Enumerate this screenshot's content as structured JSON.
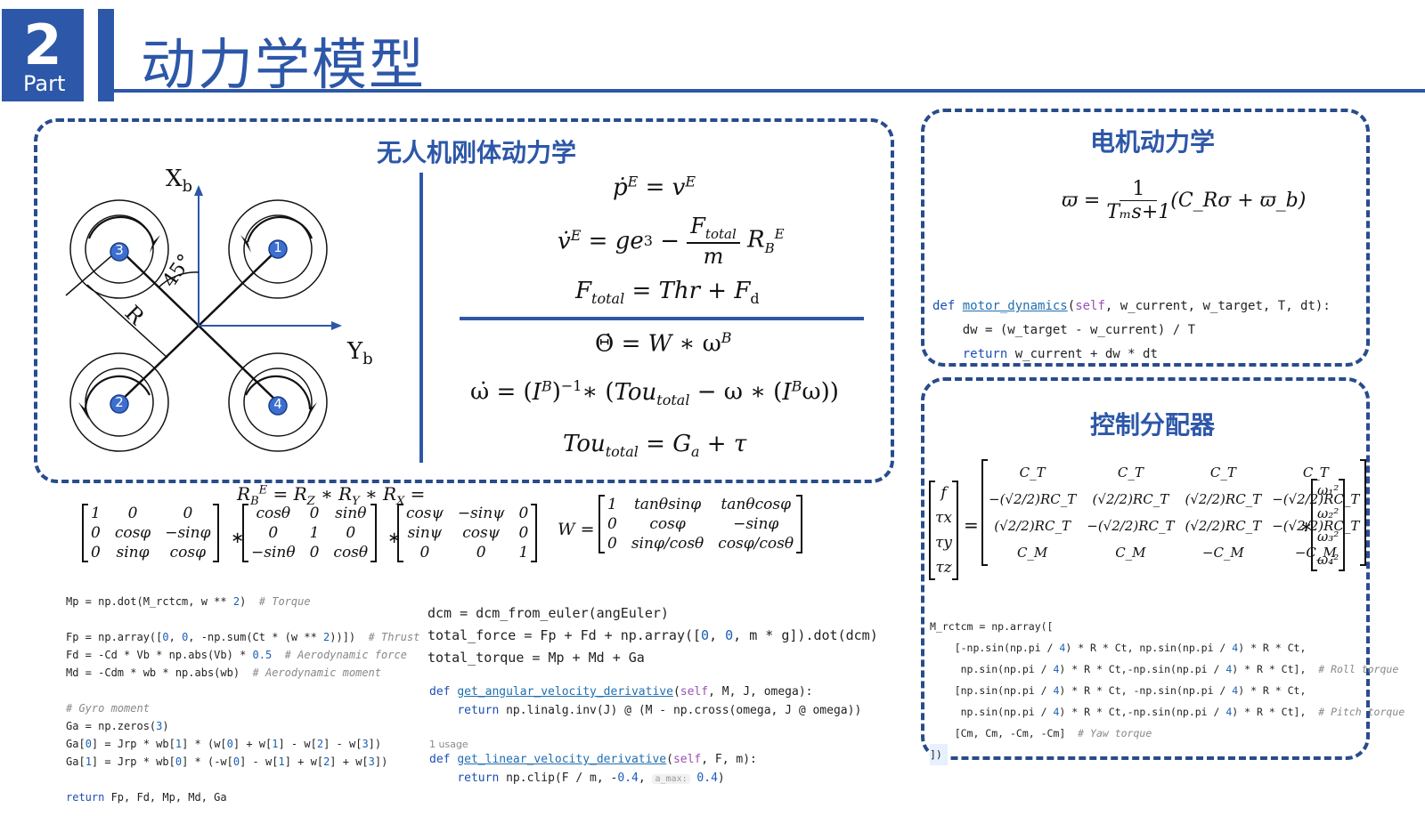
{
  "header": {
    "part_number": "2",
    "part_word": "Part",
    "title": "动力学模型"
  },
  "rigid_body": {
    "title": "无人机刚体动力学",
    "axis_x": "X",
    "axis_x_sub": "b",
    "axis_y": "Y",
    "axis_y_sub": "b",
    "angle": "45°",
    "arm": "R",
    "rotors": [
      "1",
      "2",
      "3",
      "4"
    ],
    "eq_translational": [
      "ṗᴱ = vᴱ",
      "v̇ᴱ = ge₃ − (F_total / m) R_Bᴱ",
      "F_total = Thr + F_d"
    ],
    "eq_rotational": [
      "Θ̇ = W ∗ ωᴮ",
      "ω̇ = (Iᴮ)⁻¹∗ (Tou_total − ω ∗ (Iᴮω))",
      "Tou_total = G_a + τ"
    ]
  },
  "rotation": {
    "rbe_eq": "R_Bᴱ = R_Z ∗ R_Y ∗ R_X =",
    "rx": [
      [
        "1",
        "0",
        "0"
      ],
      [
        "0",
        "cosφ",
        "−sinφ"
      ],
      [
        "0",
        "sinφ",
        "cosφ"
      ]
    ],
    "ry": [
      [
        "cosθ",
        "0",
        "sinθ"
      ],
      [
        "0",
        "1",
        "0"
      ],
      [
        "−sinθ",
        "0",
        "cosθ"
      ]
    ],
    "rz": [
      [
        "cosψ",
        "−sinψ",
        "0"
      ],
      [
        "sinψ",
        "cosψ",
        "0"
      ],
      [
        "0",
        "0",
        "1"
      ]
    ],
    "w_label": "W =",
    "w": [
      [
        "1",
        "tanθsinφ",
        "tanθcosφ"
      ],
      [
        "0",
        "cosφ",
        "−sinφ"
      ],
      [
        "0",
        "sinφ/cosθ",
        "cosφ/cosθ"
      ]
    ]
  },
  "motor": {
    "title": "电机动力学",
    "formula_lhs": "ϖ =",
    "formula_num": "1",
    "formula_den": "Tₘs+1",
    "formula_rhs": "(C_Rσ + ϖ_b)",
    "code": [
      "def motor_dynamics(self, w_current, w_target, T, dt):",
      "    dw = (w_target - w_current) / T",
      "    return w_current + dw * dt"
    ]
  },
  "allocator": {
    "title": "控制分配器",
    "lhs": [
      "f",
      "τx",
      "τy",
      "τz"
    ],
    "rhs": [
      "ω₁²",
      "ω₂²",
      "ω₃²",
      "ω₄²"
    ],
    "matrix": [
      [
        "C_T",
        "C_T",
        "C_T",
        "C_T"
      ],
      [
        "−(√2/2)RC_T",
        "(√2/2)RC_T",
        "(√2/2)RC_T",
        "−(√2/2)RC_T"
      ],
      [
        "(√2/2)RC_T",
        "−(√2/2)RC_T",
        "(√2/2)RC_T",
        "−(√2/2)RC_T"
      ],
      [
        "C_M",
        "C_M",
        "−C_M",
        "−C_M"
      ]
    ],
    "code": [
      "M_rctcm = np.array([",
      "    [-np.sin(np.pi / 4) * R * Ct, np.sin(np.pi / 4) * R * Ct,",
      "     np.sin(np.pi / 4) * R * Ct,-np.sin(np.pi / 4) * R * Ct],  # Roll torque",
      "    [np.sin(np.pi / 4) * R * Ct, -np.sin(np.pi / 4) * R * Ct,",
      "     np.sin(np.pi / 4) * R * Ct,-np.sin(np.pi / 4) * R * Ct],  # Pitch torque",
      "    [Cm, Cm, -Cm, -Cm]  # Yaw torque",
      "])"
    ]
  },
  "code_left": [
    "Mp = np.dot(M_rctcm, w ** 2)  # Torque",
    "",
    "Fp = np.array([0, 0, -np.sum(Ct * (w ** 2))])  # Thrust",
    "Fd = -Cd * Vb * np.abs(Vb) * 0.5  # Aerodynamic force",
    "Md = -Cdm * wb * np.abs(wb)  # Aerodynamic moment",
    "",
    "# Gyro moment",
    "Ga = np.zeros(3)",
    "Ga[0] = Jrp * wb[1] * (w[0] + w[1] - w[2] - w[3])",
    "Ga[1] = Jrp * wb[0] * (-w[0] - w[1] + w[2] + w[3])",
    "",
    "return Fp, Fd, Mp, Md, Ga"
  ],
  "code_mid_top": [
    "dcm = dcm_from_euler(angEuler)",
    "total_force = Fp + Fd + np.array([0, 0, m * g]).dot(dcm)",
    "total_torque = Mp + Md + Ga"
  ],
  "code_mid_bottom": {
    "line1": "def get_angular_velocity_derivative(self, M, J, omega):",
    "line2": "    return np.linalg.inv(J) @ (M - np.cross(omega, J @ omega))",
    "usage": "1 usage",
    "line3": "def get_linear_velocity_derivative(self, F, m):",
    "line4_pre": "    return np.clip(F / m, -0.4, ",
    "line4_hint": "a_max:",
    "line4_post": " 0.4)"
  }
}
